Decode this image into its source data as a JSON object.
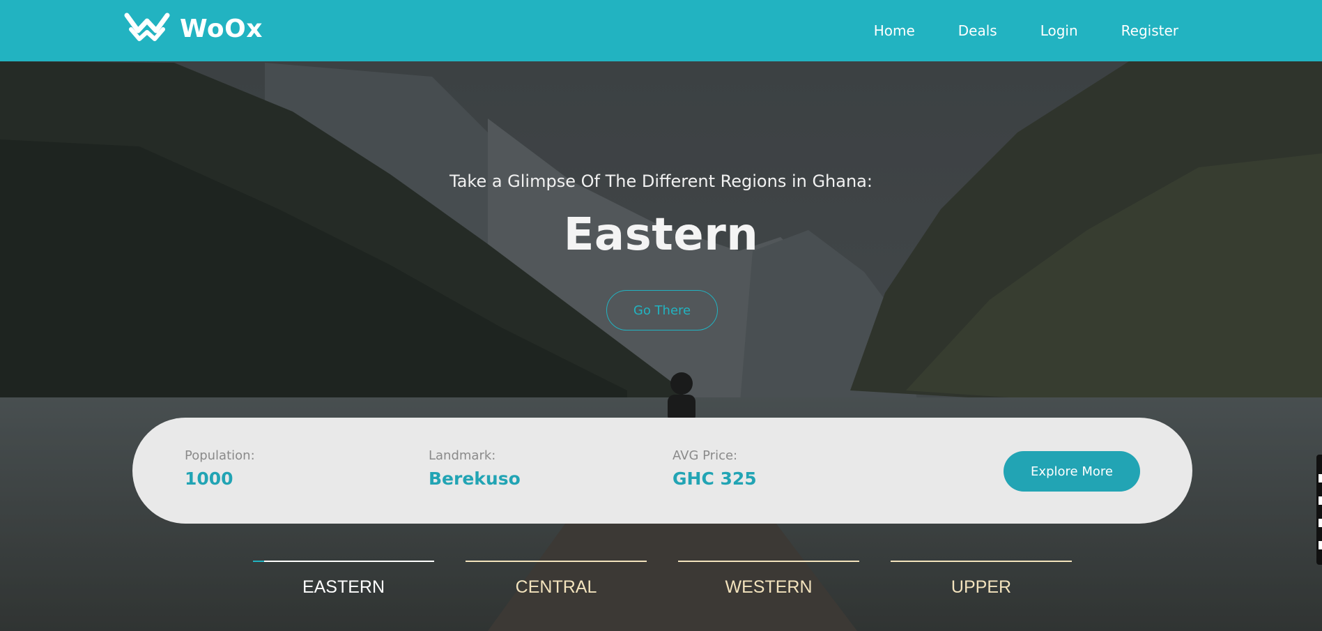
{
  "brand": {
    "name": "WoOx",
    "color_primary": "#22b3c1",
    "color_accent_value": "#22a4b4",
    "color_tab_inactive": "#f3e3bd"
  },
  "nav": {
    "items": [
      "Home",
      "Deals",
      "Login",
      "Register"
    ]
  },
  "hero": {
    "subtitle": "Take a Glimpse Of The Different Regions in Ghana:",
    "title": "Eastern",
    "cta_label": "Go There"
  },
  "info": {
    "population_label": "Population:",
    "population_value": "1000",
    "landmark_label": "Landmark:",
    "landmark_value": "Berekuso",
    "price_label": "AVG Price:",
    "price_value": "GHC 325",
    "explore_label": "Explore More"
  },
  "regions": {
    "tabs": [
      "EASTERN",
      "CENTRAL",
      "WESTERN",
      "UPPER"
    ],
    "active_index": 0,
    "active_progress": 0.06
  },
  "icons": {
    "logo": "double-chevron-w-logo-icon"
  }
}
